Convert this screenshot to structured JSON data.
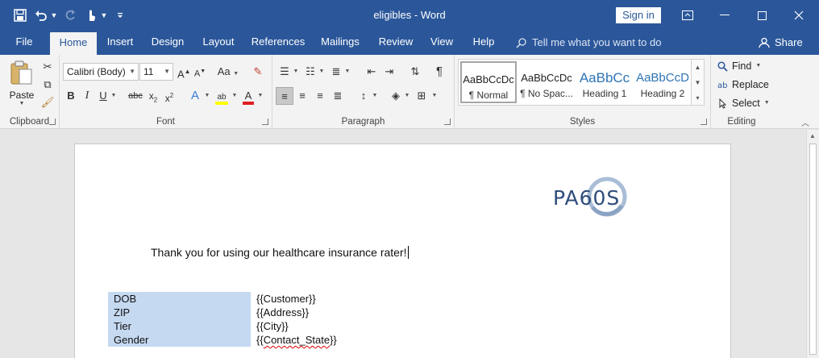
{
  "window": {
    "document_name": "eligibles",
    "separator": " - ",
    "app_name": "Word",
    "sign_in_label": "Sign in"
  },
  "tabs": [
    {
      "label": "File"
    },
    {
      "label": "Home"
    },
    {
      "label": "Insert"
    },
    {
      "label": "Design"
    },
    {
      "label": "Layout"
    },
    {
      "label": "References"
    },
    {
      "label": "Mailings"
    },
    {
      "label": "Review"
    },
    {
      "label": "View"
    },
    {
      "label": "Help"
    }
  ],
  "tell_me_placeholder": "Tell me what you want to do",
  "share_label": "Share",
  "ribbon": {
    "clipboard": {
      "label": "Clipboard",
      "paste_label": "Paste"
    },
    "font": {
      "label": "Font",
      "font_name": "Calibri (Body)",
      "font_size": "11",
      "change_case": "Aa"
    },
    "paragraph": {
      "label": "Paragraph"
    },
    "styles": {
      "label": "Styles",
      "items": [
        {
          "sample": "AaBbCcDc",
          "name": "¶ Normal"
        },
        {
          "sample": "AaBbCcDc",
          "name": "¶ No Spac..."
        },
        {
          "sample": "AaBbCc",
          "name": "Heading 1"
        },
        {
          "sample": "AaBbCcD",
          "name": "Heading 2"
        }
      ]
    },
    "editing": {
      "label": "Editing",
      "find": "Find",
      "replace": "Replace",
      "select": "Select"
    }
  },
  "document": {
    "logo_text": "PA60S",
    "body_line": "Thank you for using our healthcare insurance rater!",
    "rows": [
      {
        "label": "DOB",
        "value": "{{Customer}}"
      },
      {
        "label": "ZIP",
        "value": "{{Address}}"
      },
      {
        "label": "Tier",
        "value": "{{City}}"
      },
      {
        "label": "Gender",
        "value_prefix": "{{",
        "value_flagged": "Contact_State",
        "value_suffix": "}}"
      }
    ]
  },
  "colors": {
    "title_bar": "#2b579a",
    "ribbon_bg": "#f3f3f3",
    "table_highlight": "#c5d9f1",
    "logo_blue": "#2e4d7a",
    "logo_light": "#a9bdd6"
  }
}
